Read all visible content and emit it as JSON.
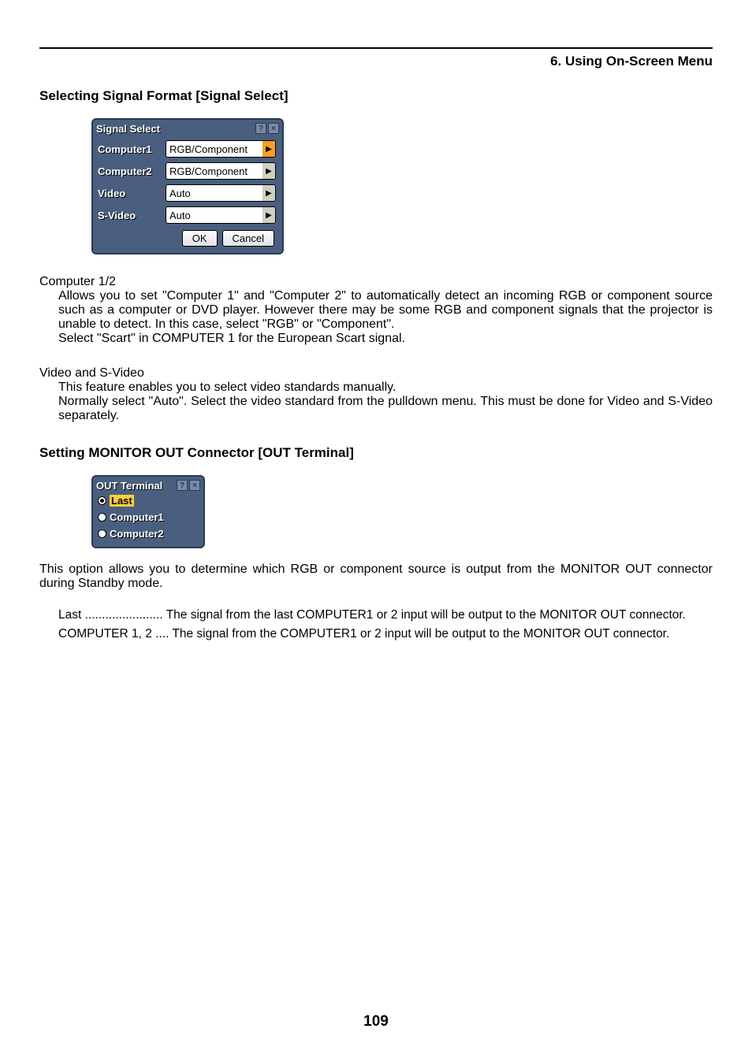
{
  "header": {
    "chapter": "6. Using On-Screen Menu"
  },
  "section1": {
    "title": "Selecting Signal Format [Signal Select]",
    "dialog": {
      "title": "Signal Select",
      "rows": [
        {
          "label": "Computer1",
          "value": "RGB/Component",
          "arrow_style": "orange"
        },
        {
          "label": "Computer2",
          "value": "RGB/Component",
          "arrow_style": "gray"
        },
        {
          "label": "Video",
          "value": "Auto",
          "arrow_style": "gray"
        },
        {
          "label": "S-Video",
          "value": "Auto",
          "arrow_style": "gray"
        }
      ],
      "ok": "OK",
      "cancel": "Cancel"
    },
    "computer_term": "Computer 1/2",
    "computer_desc": "Allows you to set \"Computer 1\" and \"Computer 2\" to automatically detect an incoming RGB or component source such as a computer or DVD player. However there may be some RGB and component signals that the projector is unable to detect. In this case, select \"RGB\" or \"Component\".",
    "computer_desc2": "Select \"Scart\" in COMPUTER 1 for the European Scart signal.",
    "video_term": "Video and S-Video",
    "video_desc1": "This feature enables you to select video standards manually.",
    "video_desc2": "Normally select \"Auto\". Select the video standard from the pulldown menu. This must be done for Video and S-Video separately."
  },
  "section2": {
    "title": "Setting MONITOR OUT Connector [OUT Terminal]",
    "dialog": {
      "title": "OUT Terminal",
      "options": [
        {
          "label": "Last",
          "selected": true
        },
        {
          "label": "Computer1",
          "selected": false
        },
        {
          "label": "Computer2",
          "selected": false
        }
      ]
    },
    "desc": "This option allows you to determine which RGB or component source is output from the MONITOR OUT connector during Standby mode.",
    "defs": [
      {
        "term": "Last ....................... ",
        "body": "The signal from the last COMPUTER1 or 2 input will be output to the MONITOR OUT connector."
      },
      {
        "term": "COMPUTER 1, 2 .... ",
        "body": "The signal from the COMPUTER1 or 2 input will be output to the MONITOR OUT connector."
      }
    ]
  },
  "page_number": "109"
}
